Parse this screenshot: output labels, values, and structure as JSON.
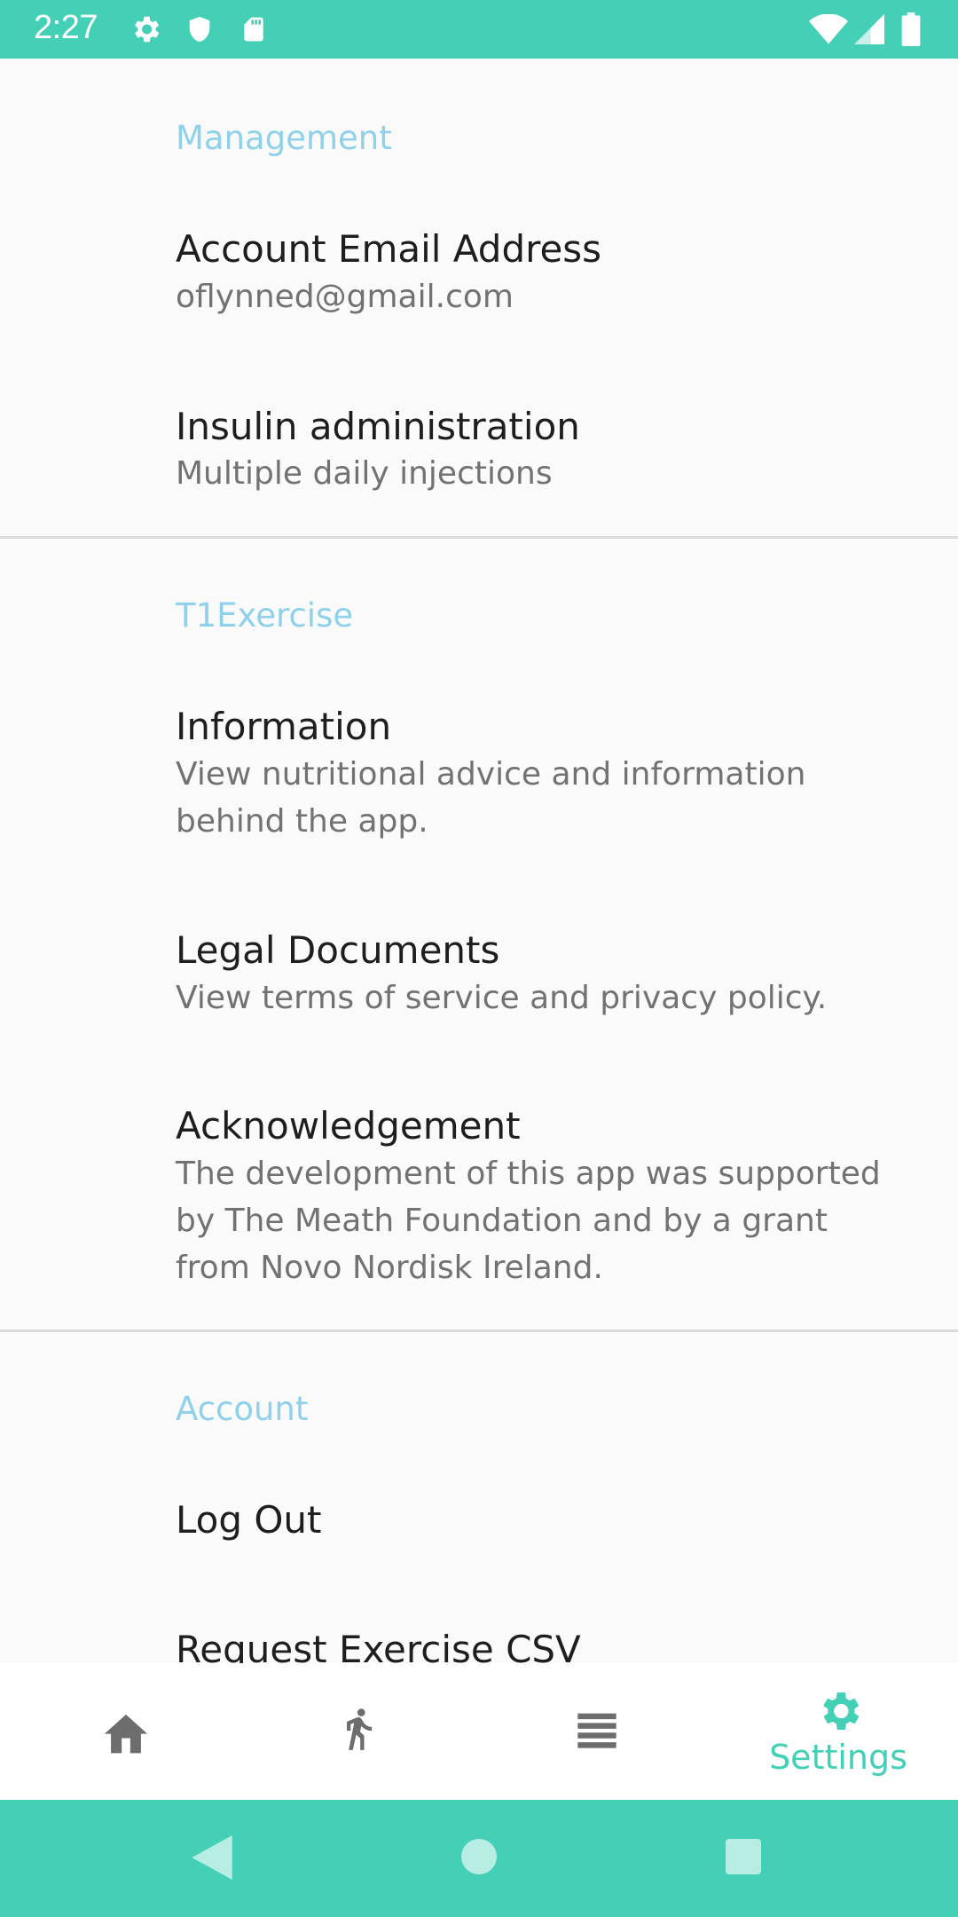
{
  "status_bar": {
    "time": "2:27",
    "icons": [
      "gear-icon",
      "shield-icon",
      "sd-card-icon",
      "wifi-icon",
      "signal-icon",
      "battery-icon"
    ]
  },
  "settings": {
    "management": {
      "header": "Management",
      "account_email": {
        "title": "Account Email Address",
        "summary": "oflynned@gmail.com"
      },
      "insulin": {
        "title": "Insulin administration",
        "summary": "Multiple daily injections"
      }
    },
    "t1exercise": {
      "header": "T1Exercise",
      "information": {
        "title": "Information",
        "summary": "View nutritional advice and information behind the app."
      },
      "legal": {
        "title": "Legal Documents",
        "summary": "View terms of service and privacy policy."
      },
      "acknowledgement": {
        "title": "Acknowledgement",
        "summary": "The development of this app was supported by The Meath Foundation and by a grant from Novo Nordisk Ireland."
      }
    },
    "account": {
      "header": "Account",
      "log_out": {
        "title": "Log Out"
      },
      "request_csv": {
        "title": "Request Exercise CSV"
      }
    }
  },
  "bottom_nav": {
    "items": [
      {
        "icon": "home-icon",
        "label": ""
      },
      {
        "icon": "running-icon",
        "label": ""
      },
      {
        "icon": "list-icon",
        "label": ""
      },
      {
        "icon": "gear-icon",
        "label": "Settings",
        "active": true
      }
    ]
  },
  "colors": {
    "accent": "#44d0b6",
    "category_header": "#8fd1ea",
    "inactive_icon": "#6d6d6d"
  }
}
